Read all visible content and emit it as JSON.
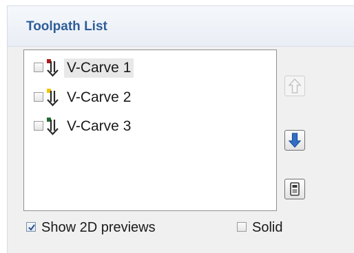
{
  "panel": {
    "title": "Toolpath List"
  },
  "toolpaths": [
    {
      "label": "V-Carve 1",
      "checked": false,
      "color": "#b01818",
      "selected": true
    },
    {
      "label": "V-Carve 2",
      "checked": false,
      "color": "#f2c400",
      "selected": false
    },
    {
      "label": "V-Carve 3",
      "checked": false,
      "color": "#1e6b2f",
      "selected": false
    }
  ],
  "buttons": {
    "move_up_icon": "arrow-up-icon",
    "move_down_icon": "arrow-down-icon",
    "calculate_icon": "calculator-icon"
  },
  "options": {
    "show_previews_label": "Show 2D previews",
    "show_previews_checked": true,
    "solid_label": "Solid",
    "solid_checked": false
  },
  "colors": {
    "title": "#2f5d98",
    "down_arrow": "#2f6fc7"
  }
}
